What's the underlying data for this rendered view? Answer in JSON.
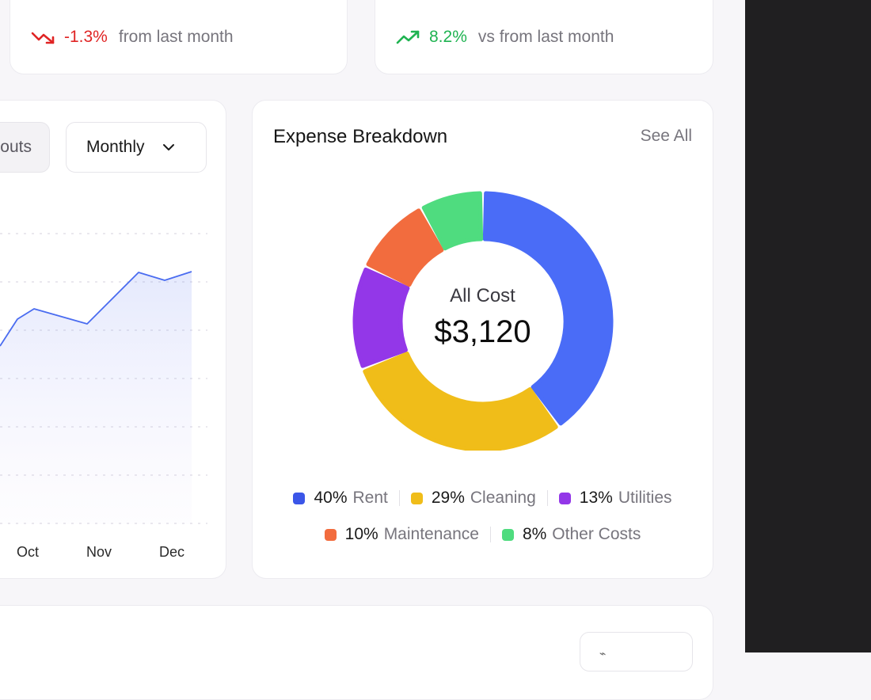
{
  "kpi_cards": [
    {
      "change": "-1.3%",
      "caption": "from last month",
      "trend": "down",
      "color": "#e02424"
    },
    {
      "change": "8.2%",
      "caption": "vs from last month",
      "trend": "up",
      "color": "#1fb351"
    }
  ],
  "revenue_chart": {
    "payouts_label": "outs",
    "period_label": "Monthly",
    "x_labels": [
      "Oct",
      "Nov",
      "Dec"
    ],
    "line_color": "#4a6cf0"
  },
  "expense_breakdown": {
    "title": "Expense Breakdown",
    "see_all_label": "See All",
    "center_label": "All Cost",
    "center_value": "$3,120",
    "chart_data": {
      "type": "pie",
      "title": "Expense Breakdown",
      "slices": [
        {
          "label": "Rent",
          "pct": 40,
          "pct_label": "40%",
          "color": "#4a6cf7"
        },
        {
          "label": "Cleaning",
          "pct": 29,
          "pct_label": "29%",
          "color": "#f0bd19"
        },
        {
          "label": "Utilities",
          "pct": 13,
          "pct_label": "13%",
          "color": "#9337e8"
        },
        {
          "label": "Maintenance",
          "pct": 10,
          "pct_label": "10%",
          "color": "#f26c3e"
        },
        {
          "label": "Other Costs",
          "pct": 8,
          "pct_label": "8%",
          "color": "#4fdc7f"
        }
      ]
    }
  }
}
